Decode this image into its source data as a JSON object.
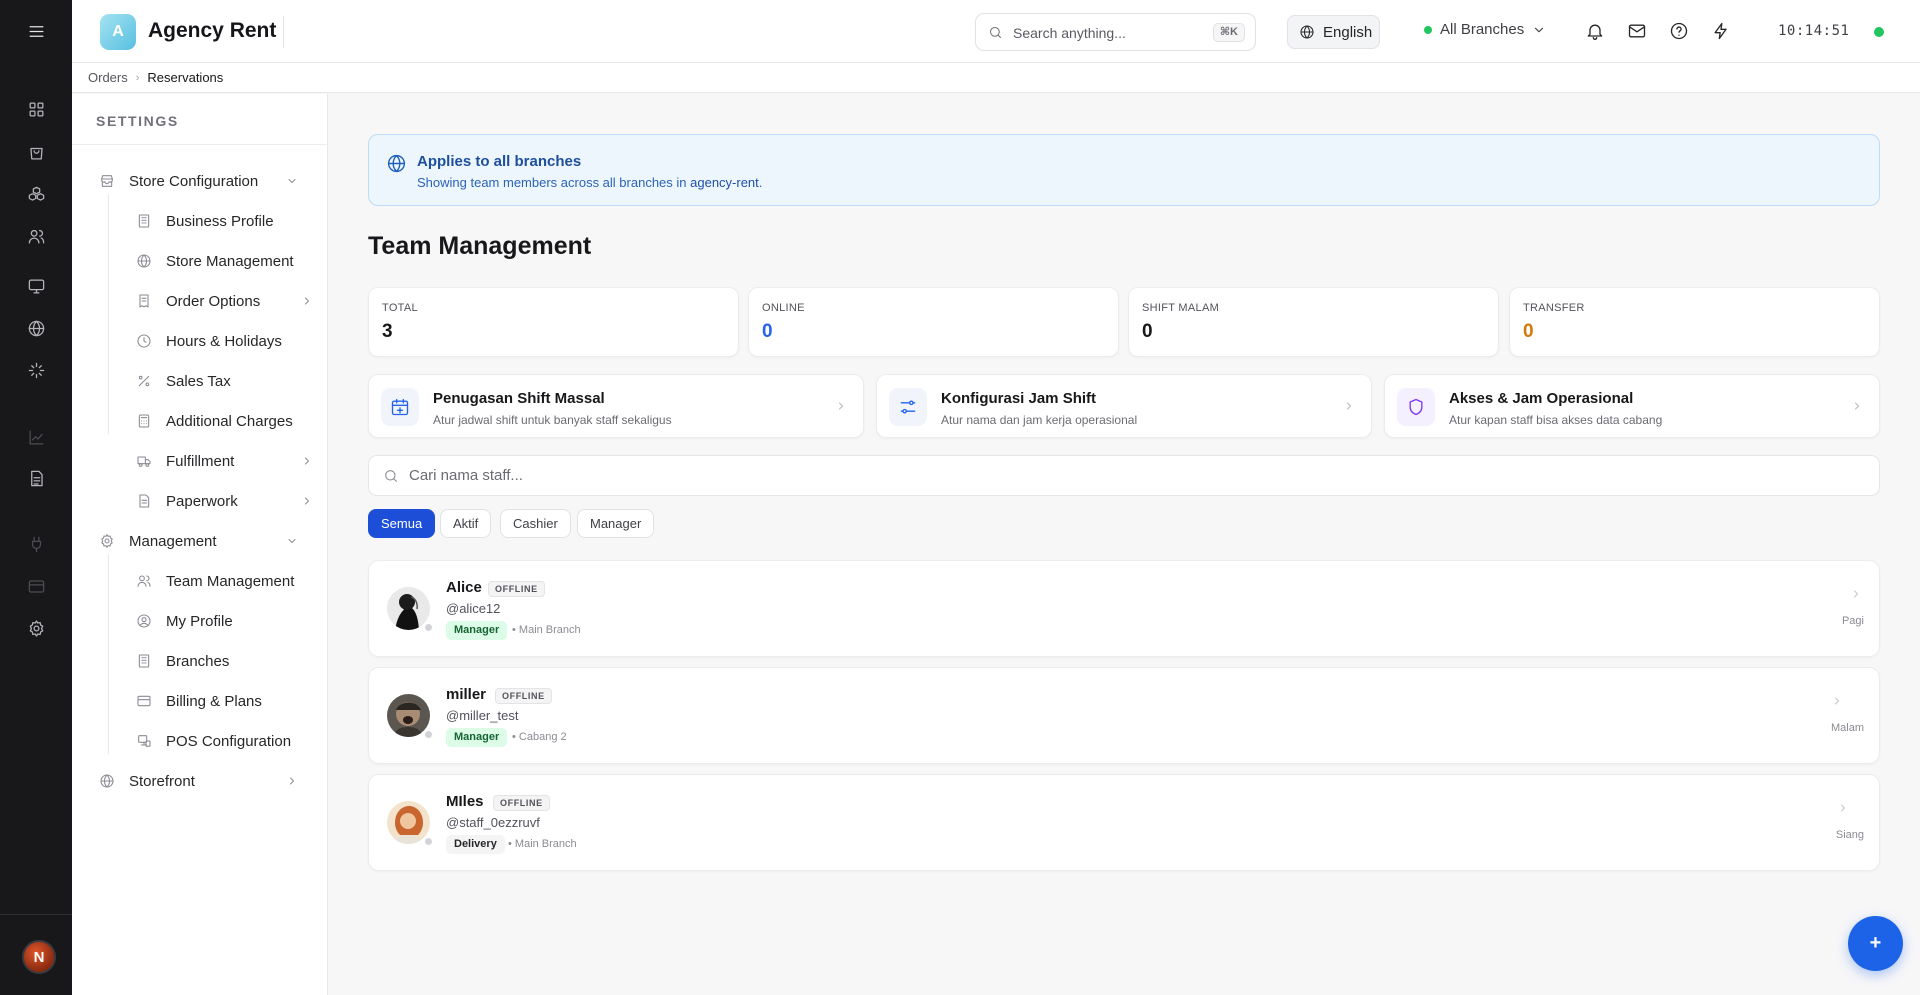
{
  "app": {
    "logo_letter": "A",
    "title": "Agency Rent"
  },
  "header": {
    "search_placeholder": "Search anything...",
    "search_shortcut": "⌘K",
    "language": "English",
    "branch_selector": "All Branches",
    "clock": "10:14:51"
  },
  "breadcrumb": {
    "parent": "Orders",
    "current": "Reservations"
  },
  "rail": {
    "avatar_letter": "N"
  },
  "sidebar": {
    "title": "SETTINGS",
    "sections": [
      {
        "label": "Store Configuration",
        "icon": "store-icon",
        "expanded": true,
        "items": [
          {
            "label": "Business Profile",
            "icon": "building-icon"
          },
          {
            "label": "Store Management",
            "icon": "globe-icon"
          },
          {
            "label": "Order Options",
            "icon": "receipt-icon",
            "has_submenu": true
          },
          {
            "label": "Hours & Holidays",
            "icon": "clock-icon"
          },
          {
            "label": "Sales Tax",
            "icon": "percent-icon"
          },
          {
            "label": "Additional Charges",
            "icon": "calculator-icon"
          },
          {
            "label": "Fulfillment",
            "icon": "truck-icon",
            "has_submenu": true
          },
          {
            "label": "Paperwork",
            "icon": "document-icon",
            "has_submenu": true
          }
        ]
      },
      {
        "label": "Management",
        "icon": "gear-icon",
        "expanded": true,
        "items": [
          {
            "label": "Team Management",
            "icon": "users-icon"
          },
          {
            "label": "My Profile",
            "icon": "user-circle-icon"
          },
          {
            "label": "Branches",
            "icon": "building-icon"
          },
          {
            "label": "Billing & Plans",
            "icon": "credit-card-icon"
          },
          {
            "label": "POS Configuration",
            "icon": "pos-icon"
          }
        ]
      },
      {
        "label": "Storefront",
        "icon": "globe-icon",
        "expanded": false,
        "items": []
      }
    ]
  },
  "banner": {
    "title": "Applies to all branches",
    "subtitle_prefix": "Showing team members across all branches in ",
    "subtitle_org": "agency-rent",
    "subtitle_suffix": "."
  },
  "page": {
    "title": "Team Management"
  },
  "stats": [
    {
      "label": "TOTAL",
      "value": "3",
      "color": "#18181b"
    },
    {
      "label": "ONLINE",
      "value": "0",
      "color": "#2563eb"
    },
    {
      "label": "SHIFT MALAM",
      "value": "0",
      "color": "#18181b"
    },
    {
      "label": "TRANSFER",
      "value": "0",
      "color": "#d97706"
    }
  ],
  "actions": [
    {
      "title": "Penugasan Shift Massal",
      "subtitle": "Atur jadwal shift untuk banyak staff sekaligus",
      "icon": "calendar-plus-icon",
      "color": "#2563eb"
    },
    {
      "title": "Konfigurasi Jam Shift",
      "subtitle": "Atur nama dan jam kerja operasional",
      "icon": "sliders-icon",
      "color": "#2563eb"
    },
    {
      "title": "Akses & Jam Operasional",
      "subtitle": "Atur kapan staff bisa akses data cabang",
      "icon": "shield-icon",
      "color": "#7c3aed"
    }
  ],
  "staff_search": {
    "placeholder": "Cari nama staff..."
  },
  "filters": [
    "Semua",
    "Aktif",
    "Cashier",
    "Manager"
  ],
  "active_filter": "Semua",
  "members": [
    {
      "name": "Alice",
      "status": "OFFLINE",
      "username": "@alice12",
      "role": "Manager",
      "branch": "• Main Branch",
      "shift": "Pagi"
    },
    {
      "name": "miller",
      "status": "OFFLINE",
      "username": "@miller_test",
      "role": "Manager",
      "branch": "• Cabang 2",
      "shift": "Malam"
    },
    {
      "name": "MIles",
      "status": "OFFLINE",
      "username": "@staff_0ezzruvf",
      "role": "Delivery",
      "branch": "• Main Branch",
      "shift": "Siang"
    }
  ],
  "fab": {
    "label": "+"
  },
  "colors": {
    "accent": "#1d4ed8",
    "online": "#22c55e",
    "rail": "#18181b"
  }
}
